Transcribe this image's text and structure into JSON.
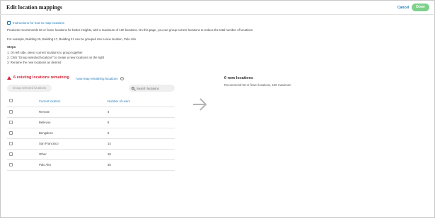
{
  "header": {
    "title": "Edit location mappings",
    "cancel_label": "Cancel",
    "done_label": "Done"
  },
  "intro": {
    "instructions_link": "Instructions for how to map locations",
    "paragraph": "Productiv recommends 50 or fewer locations for better insights, with a maximum of 100 locations. On this page, you can group current locations to reduce the total number of locations.",
    "example": "For example, Building 15, Building 17, Building 21 can be grouped into a new location, Palo Alto"
  },
  "steps": {
    "heading": "Steps",
    "items": [
      "1. On left side, select current locations to group together",
      "2. Click \"Group selected locations\" to create a new locations on the right",
      "3. Rename the new locations as desired"
    ]
  },
  "left": {
    "remaining_text": "6 existing locations remaining",
    "automap_label": "Auto-map remaining locations",
    "group_button": "Group selected locations",
    "search_placeholder": "Search locations",
    "columns": [
      "Current location",
      "Number of users"
    ],
    "rows": [
      {
        "location": "Remote",
        "users": "4"
      },
      {
        "location": "Bellevue",
        "users": "8"
      },
      {
        "location": "Bengaluru",
        "users": "9"
      },
      {
        "location": "San Francisco",
        "users": "14"
      },
      {
        "location": "Other",
        "users": "18"
      },
      {
        "location": "Palo Alto",
        "users": "35"
      }
    ]
  },
  "right": {
    "heading": "0 new locations",
    "subtext": "Recommend 50 or fewer locations, 100 maximum"
  },
  "colors": {
    "accent": "#1f7ab8",
    "warning": "#d0243a",
    "done_button": "#7ed08b"
  }
}
